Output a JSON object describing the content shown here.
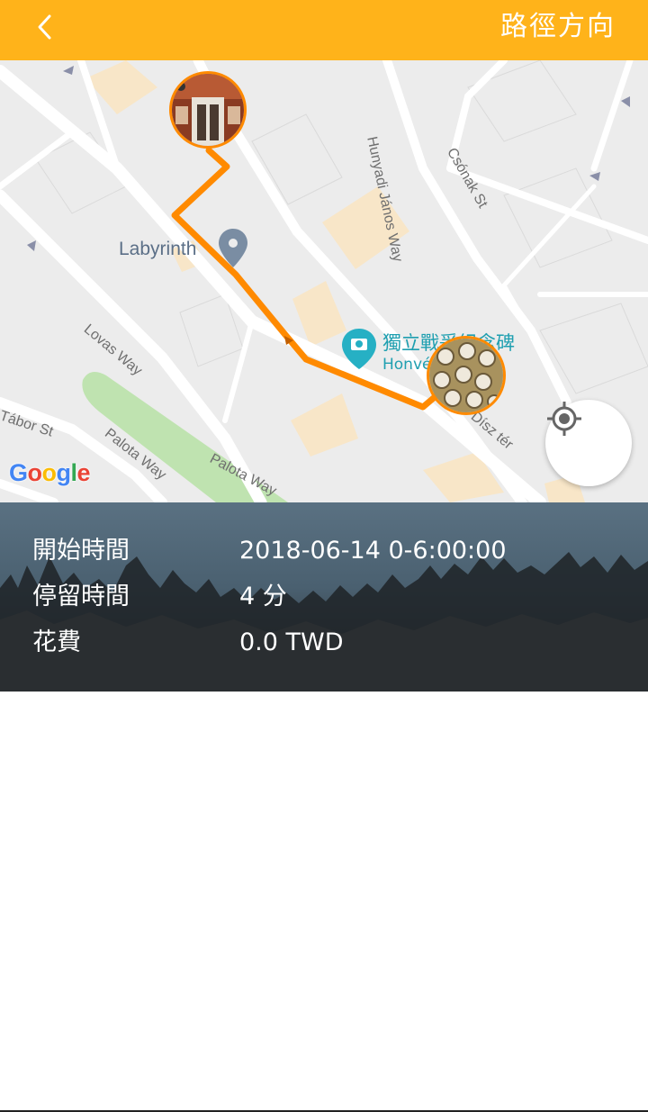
{
  "header": {
    "title": "路徑方向",
    "back_icon": "chevron-left-icon"
  },
  "map": {
    "streets": [
      "Hunyadi János Way",
      "Csónak St",
      "Lovas Way",
      "Tábor St",
      "Palota Way",
      "Palota Way",
      "Dísz tér"
    ],
    "places": {
      "labyrinth": "Labyrinth",
      "monument_name": "獨立戰爭紀念碑",
      "monument_sub": "Honvé"
    },
    "attribution": "Google",
    "locate_icon": "my-location-icon",
    "route_color": "#FF8A00"
  },
  "info": {
    "rows": [
      {
        "label": "開始時間",
        "value": "2018-06-14 0-6:00:00"
      },
      {
        "label": "停留時間",
        "value": "4 分"
      },
      {
        "label": "花費",
        "value": "0.0  TWD"
      }
    ]
  },
  "colors": {
    "header": "#FFB31A",
    "route": "#FF8A00",
    "poi": "#1f9fb0"
  }
}
